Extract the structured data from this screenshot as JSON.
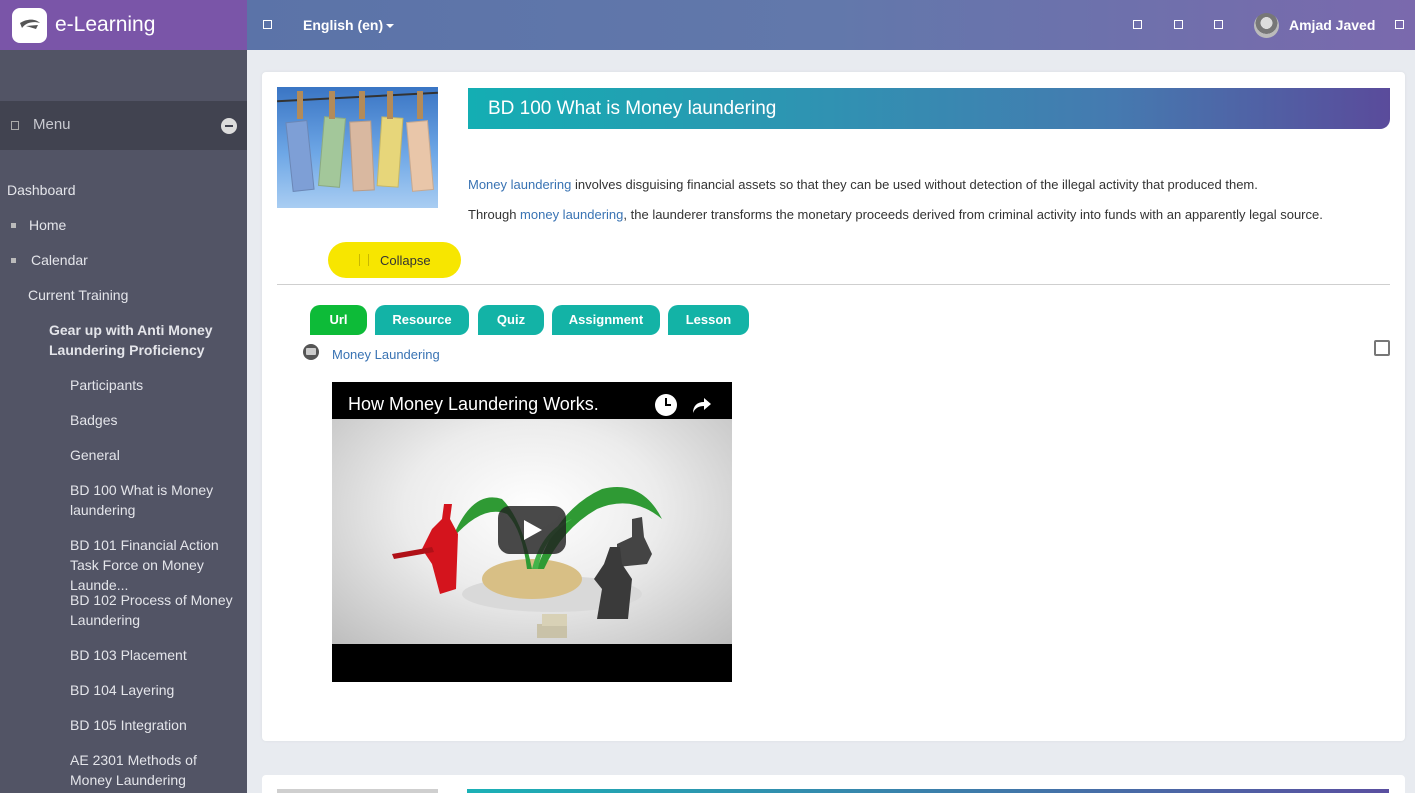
{
  "brand": {
    "title": "e-Learning"
  },
  "topbar": {
    "language": "English (en)",
    "user_name": "Amjad Javed"
  },
  "sidebar": {
    "menu_label": "Menu",
    "items": [
      {
        "label": "Dashboard"
      },
      {
        "label": "Home"
      },
      {
        "label": "Calendar"
      },
      {
        "label": "Current Training"
      },
      {
        "label": "Gear up with Anti Money Laundering Proficiency"
      },
      {
        "label": "Participants"
      },
      {
        "label": "Badges"
      },
      {
        "label": "General"
      },
      {
        "label": "BD 100 What is Money laundering"
      },
      {
        "label": "BD 101 Financial Action Task Force on Money Launde..."
      },
      {
        "label": "BD 102 Process of Money Laundering"
      },
      {
        "label": "BD 103 Placement"
      },
      {
        "label": "BD 104 Layering"
      },
      {
        "label": "BD 105 Integration"
      },
      {
        "label": "AE 2301 Methods of Money Laundering"
      }
    ]
  },
  "section": {
    "title": "BD 100 What is Money laundering",
    "para1_link": "Money laundering",
    "para1_text": " involves disguising financial assets so that they can be used without detection of the illegal activity that produced them.",
    "para2_pre": "Through ",
    "para2_link": "money laundering",
    "para2_text": ", the launderer transforms the monetary proceeds derived from criminal activity into funds with an apparently legal source.",
    "collapse_label": "Collapse"
  },
  "tabs": [
    {
      "label": "Url"
    },
    {
      "label": "Resource"
    },
    {
      "label": "Quiz"
    },
    {
      "label": "Assignment"
    },
    {
      "label": "Lesson"
    }
  ],
  "resource": {
    "link_label": "Money Laundering"
  },
  "video": {
    "title": "How Money Laundering Works."
  },
  "colors": {
    "brand": "#7a55a8",
    "accent_yellow": "#f7e600",
    "tab_active": "#0dbb38",
    "tab": "#13b3a6",
    "link": "#3973b3"
  }
}
